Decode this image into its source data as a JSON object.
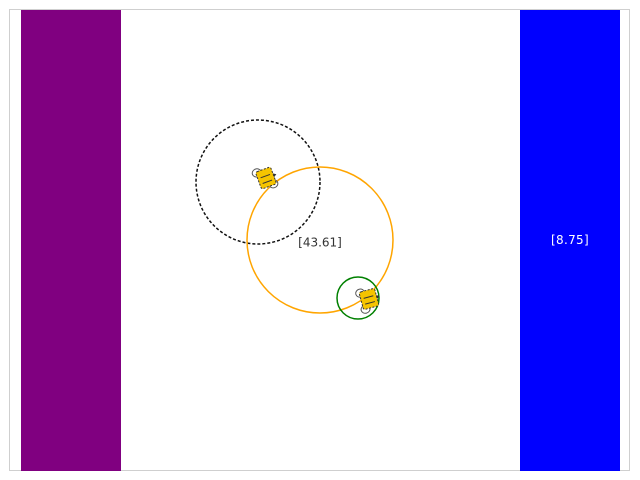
{
  "scene": {
    "left_bar_color": "#800080",
    "right_bar_color": "#0000ff",
    "right_bar_label": "[8.75]",
    "center_label": "[43.61]",
    "main_ring_color": "#ffa500",
    "small_ring_color": "#008000",
    "dashed_ring_color": "#111111",
    "bee_color": "#f5c400"
  }
}
